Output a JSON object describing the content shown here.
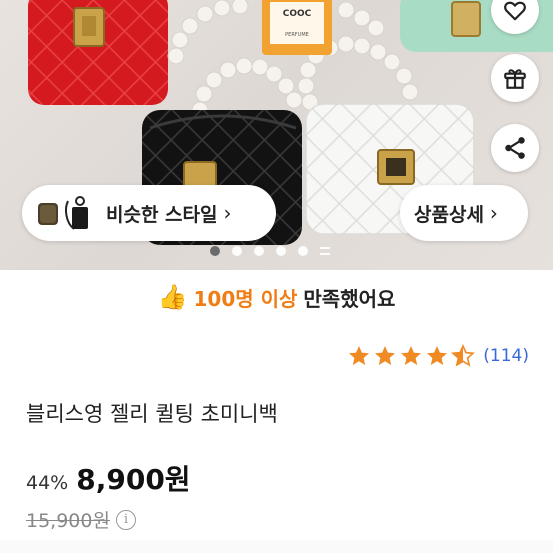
{
  "product_image": {
    "perfume_label_top": "COOC",
    "perfume_label_bottom": "PERFUME"
  },
  "side_actions": [
    {
      "name": "heart-icon"
    },
    {
      "name": "gift-icon"
    },
    {
      "name": "share-icon"
    }
  ],
  "similar_style": {
    "label": "비슷한 스타일"
  },
  "product_detail": {
    "label": "상품상세"
  },
  "carousel": {
    "total_dots": 5,
    "active_index": 0
  },
  "satisfaction": {
    "icon": "👍",
    "highlight": "100명 이상",
    "rest": "만족했어요"
  },
  "rating": {
    "stars": 4.5,
    "review_count": "(114)",
    "star_color": "#f08a24"
  },
  "product": {
    "title": "블리스영 젤리 퀼팅 초미니백",
    "discount": "44%",
    "price": "8,900원",
    "original_price": "15,900원"
  },
  "colors": {
    "accent_orange": "#f07c14",
    "link_blue": "#3a6ad8"
  }
}
